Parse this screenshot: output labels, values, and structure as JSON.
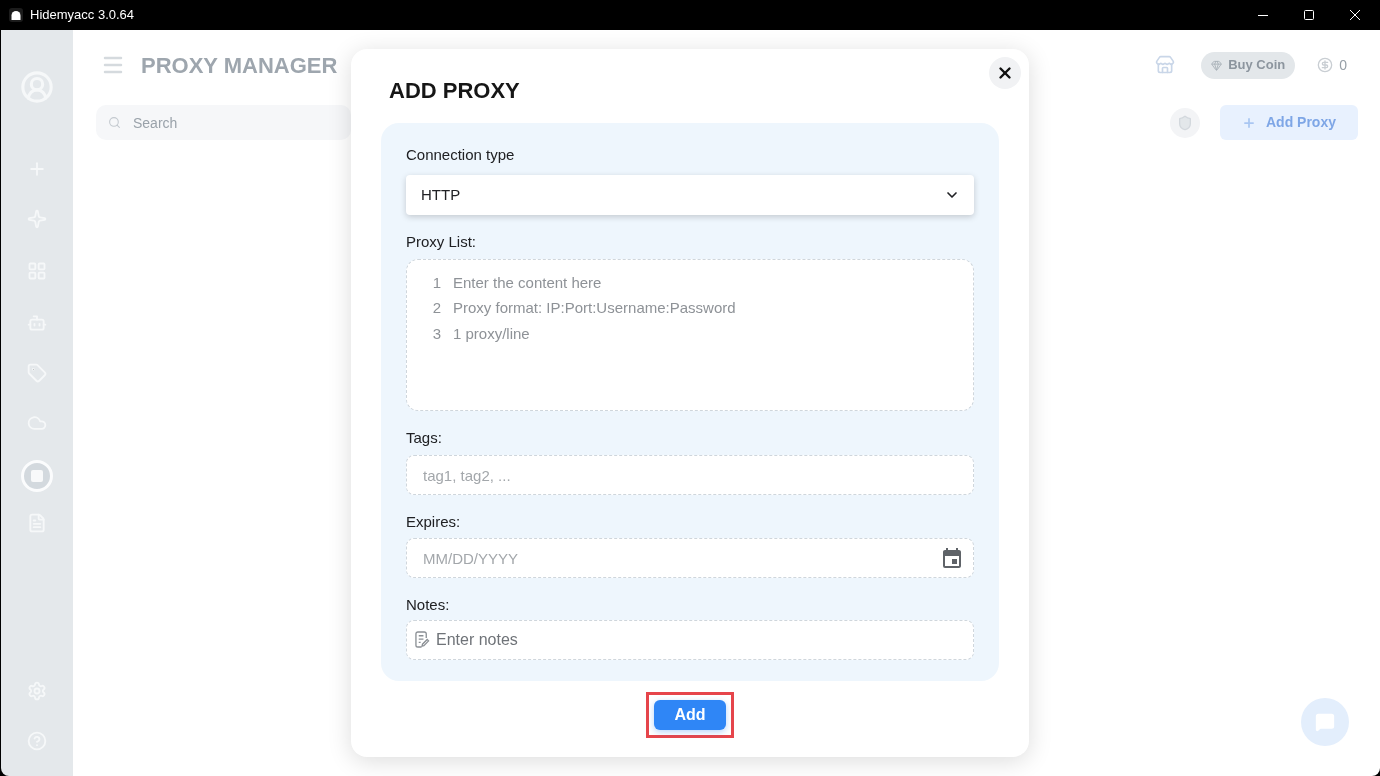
{
  "window": {
    "title": "Hidemyacc 3.0.64"
  },
  "header": {
    "title": "PROXY MANAGER",
    "buy_coin_button": "Buy Coin",
    "coin_balance": "0"
  },
  "toolbar": {
    "search": {
      "placeholder": "Search"
    },
    "add_proxy_button": "Add Proxy"
  },
  "dialog": {
    "title": "ADD PROXY",
    "fields": [
      {
        "kind": "select",
        "label": "Connection type",
        "value": "HTTP"
      },
      {
        "kind": "lines",
        "label": "Proxy List:",
        "placeholder_lines": [
          {
            "number": "1",
            "text": "Enter the content here"
          },
          {
            "number": "2",
            "text": "Proxy format: IP:Port:Username:Password"
          },
          {
            "number": "3",
            "text": "1 proxy/line"
          }
        ]
      },
      {
        "kind": "text",
        "label": "Tags:",
        "placeholder": "tag1, tag2, ..."
      },
      {
        "kind": "date",
        "label": "Expires:",
        "placeholder": "MM/DD/YYYY"
      },
      {
        "kind": "notes",
        "label": "Notes:",
        "placeholder": "Enter notes"
      }
    ],
    "submit_button": {
      "label": "Add",
      "highlighted": true
    }
  }
}
